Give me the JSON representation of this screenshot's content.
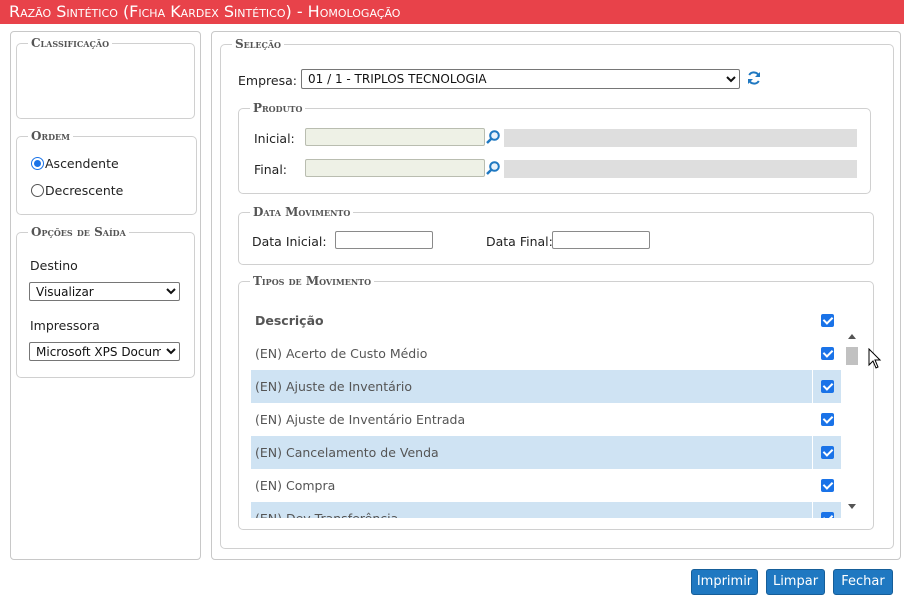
{
  "window": {
    "title": "Razão Sintético (Ficha Kardex Sintético)  - Homologação"
  },
  "left": {
    "classificacao_legend": "Classificação",
    "ordem_legend": "Ordem",
    "ordem_options": [
      "Ascendente",
      "Decrescente"
    ],
    "ordem_selected": "Ascendente",
    "saida_legend": "Opções de Saída",
    "destino_label": "Destino",
    "destino_value": "Visualizar",
    "impressora_label": "Impressora",
    "impressora_value": "Microsoft XPS Document Writer"
  },
  "selecao": {
    "legend": "Seleção",
    "empresa_label": "Empresa:",
    "empresa_value": "01 / 1 - TRIPLOS TECNOLOGIA",
    "produto": {
      "legend": "Produto",
      "inicial_label": "Inicial:",
      "final_label": "Final:"
    },
    "data_movimento": {
      "legend": "Data Movimento",
      "inicial_label": "Data Inicial:",
      "final_label": "Data Final:"
    },
    "tipos": {
      "legend": "Tipos de Movimento",
      "header": "Descrição",
      "rows": [
        "(EN) Acerto de Custo Médio",
        "(EN) Ajuste de Inventário",
        "(EN) Ajuste de Inventário Entrada",
        "(EN) Cancelamento de Venda",
        "(EN) Compra",
        "(EN) Dev Transferência"
      ]
    }
  },
  "buttons": {
    "imprimir": "Imprimir",
    "limpar": "Limpar",
    "fechar": "Fechar"
  },
  "colors": {
    "title_bar": "#e8424a",
    "button": "#1f78c1",
    "row_highlight": "#cfe3f3",
    "checkbox": "#1a73e8"
  },
  "icons": {
    "refresh": "refresh-icon",
    "search": "magnifier-icon"
  }
}
